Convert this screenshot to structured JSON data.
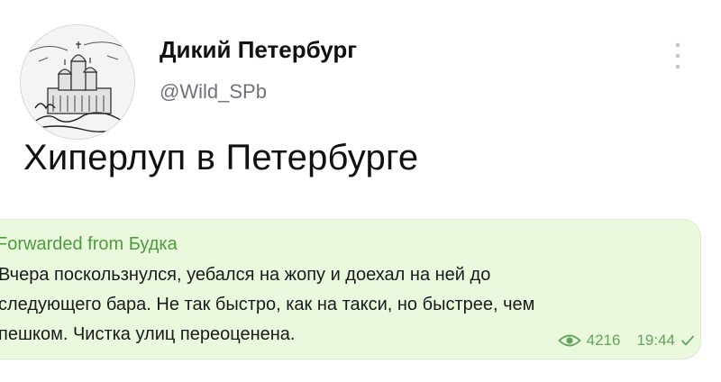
{
  "author": {
    "name": "Дикий Петербург",
    "handle": "@Wild_SPb",
    "avatar_icon": "cathedral-sketch-avatar"
  },
  "menu_icon": "more-vertical-icon",
  "tweet": {
    "text": "Хиперлуп в Петербурге"
  },
  "message": {
    "forwarded_label": "Forwarded from Будка",
    "lines": [
      "Вчера поскользнулся, уебался на жопу и доехал на ней до",
      "следующего бара. Не так быстро, как на такси, но быстрее, чем",
      "пешком. Чистка улиц переоценена."
    ],
    "views": "4216",
    "time": "19:44",
    "views_icon": "eye-icon",
    "status_icon": "check-icon"
  },
  "colors": {
    "bubble_background": "#eaf9de",
    "forwarded_accent": "#4d9c3b",
    "meta_green": "#64a45a"
  }
}
